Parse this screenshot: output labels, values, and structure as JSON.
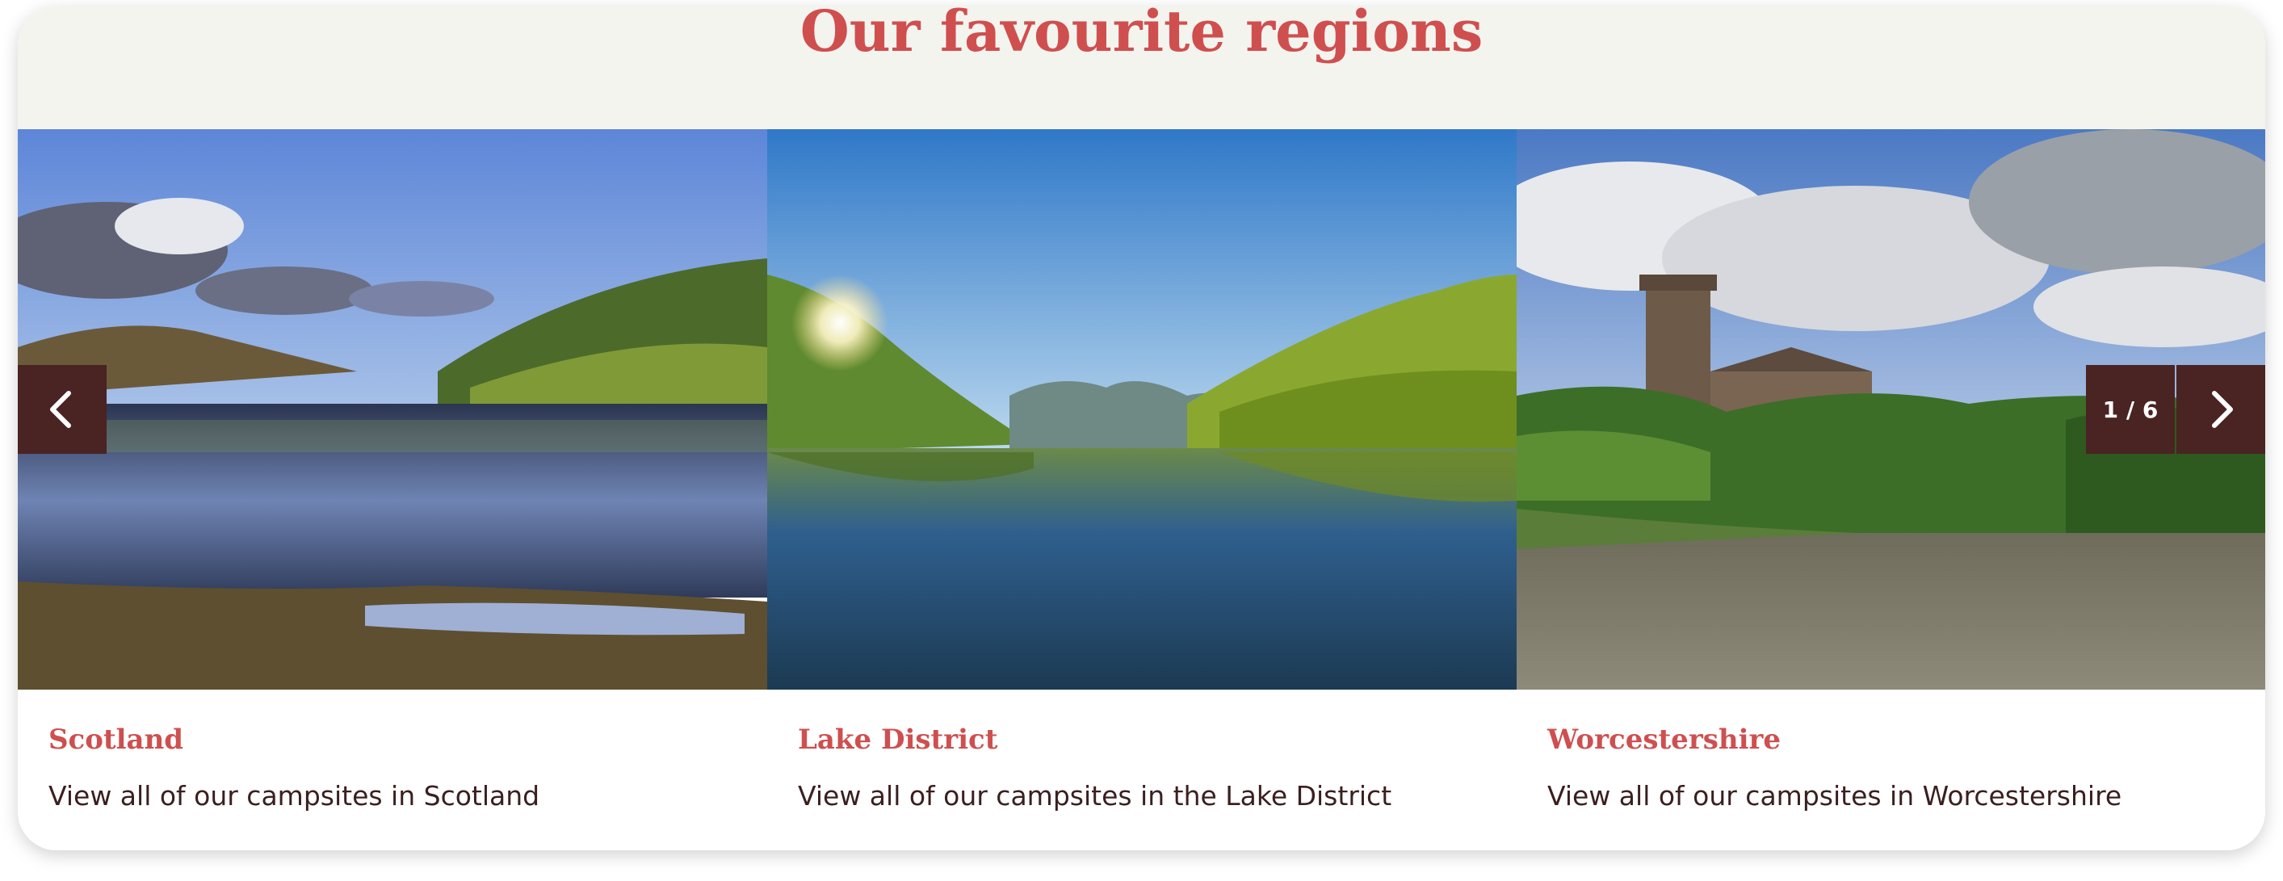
{
  "section": {
    "title": "Our favourite regions"
  },
  "slides": [
    {
      "title": "Scotland",
      "description": "View all of our campsites in Scotland",
      "image": "scotland-loch-photo"
    },
    {
      "title": "Lake District",
      "description": "View all of our campsites in the Lake District",
      "image": "lake-district-lake-photo"
    },
    {
      "title": "Worcestershire",
      "description": "View all of our campsites in Worcestershire",
      "image": "worcester-cathedral-river-photo"
    }
  ],
  "carousel": {
    "counter": "1 / 6",
    "prev_icon": "chevron-left-icon",
    "next_icon": "chevron-right-icon"
  },
  "colors": {
    "accent": "#cf4f4f",
    "nav_bg": "#4a2323",
    "header_bg": "#f4f4ef",
    "text": "#3b1f1f"
  }
}
